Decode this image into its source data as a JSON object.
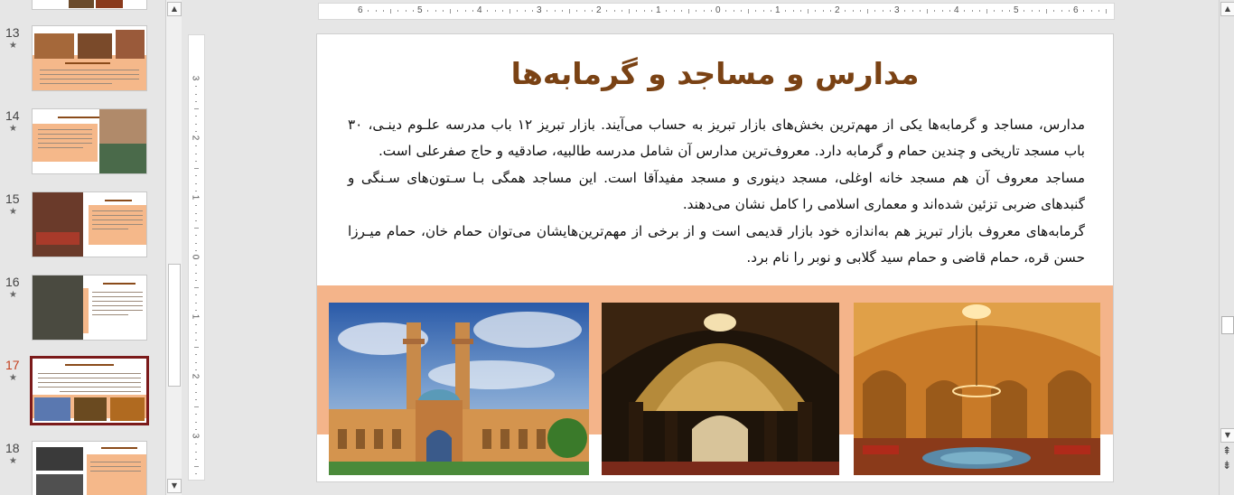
{
  "thumbnails": [
    {
      "number": "13",
      "mark": "★"
    },
    {
      "number": "14",
      "mark": "★"
    },
    {
      "number": "15",
      "mark": "★"
    },
    {
      "number": "16",
      "mark": "★"
    },
    {
      "number": "17",
      "mark": "★"
    },
    {
      "number": "18",
      "mark": "★"
    }
  ],
  "scrollbar": {
    "up": "▲",
    "down": "▼",
    "prev_slide": "⇞",
    "next_slide": "⇟"
  },
  "ruler": {
    "top_labels": [
      "6",
      "5",
      "4",
      "3",
      "2",
      "1",
      "0",
      "1",
      "2",
      "3",
      "4",
      "5",
      "6"
    ],
    "left_labels": [
      "3",
      "2",
      "1",
      "0",
      "1",
      "2",
      "3"
    ]
  },
  "slide": {
    "title": "مدارس و مساجد و گرمابه‌ها",
    "paragraphs": [
      "مدارس، مساجد و گرمابه‌ها یکی از مهم‌ترین بخش‌های بازار تبریز به حساب می‌آیند. بازار تبریز ۱۲ باب مدرسه علـوم دینـی، ۳۰ باب مسجد تاریخی و چندین حمام و گرمابه دارد. معروف‌ترین مدارس آن شامل مدرسه طالبیه، صادقیه و حاج صفرعلی است.",
      "مساجد معروف آن هم مسجد خانه اوغلی، مسجد دینوری و مسجد مفیدآقا است. این مساجد همگی بـا سـتون‌های سـنگی و گنبدهای ضربی تزئین شده‌اند و معماری اسلامی را کامل نشان می‌دهند.",
      "گرمابه‌های معروف بازار تبریز هم به‌اندازه خود بازار قدیمی است و از برخی از مهم‌ترین‌هایشان می‌توان حمام خان، حمام میـرزا حسن قره، حمام قاضی و حمام سید گلابی و نوبر را نام برد."
    ]
  },
  "colors": {
    "accent": "#f4b48a",
    "title": "#7a4214",
    "selected_border": "#7b1a1a",
    "active_number": "#c43e1c"
  }
}
